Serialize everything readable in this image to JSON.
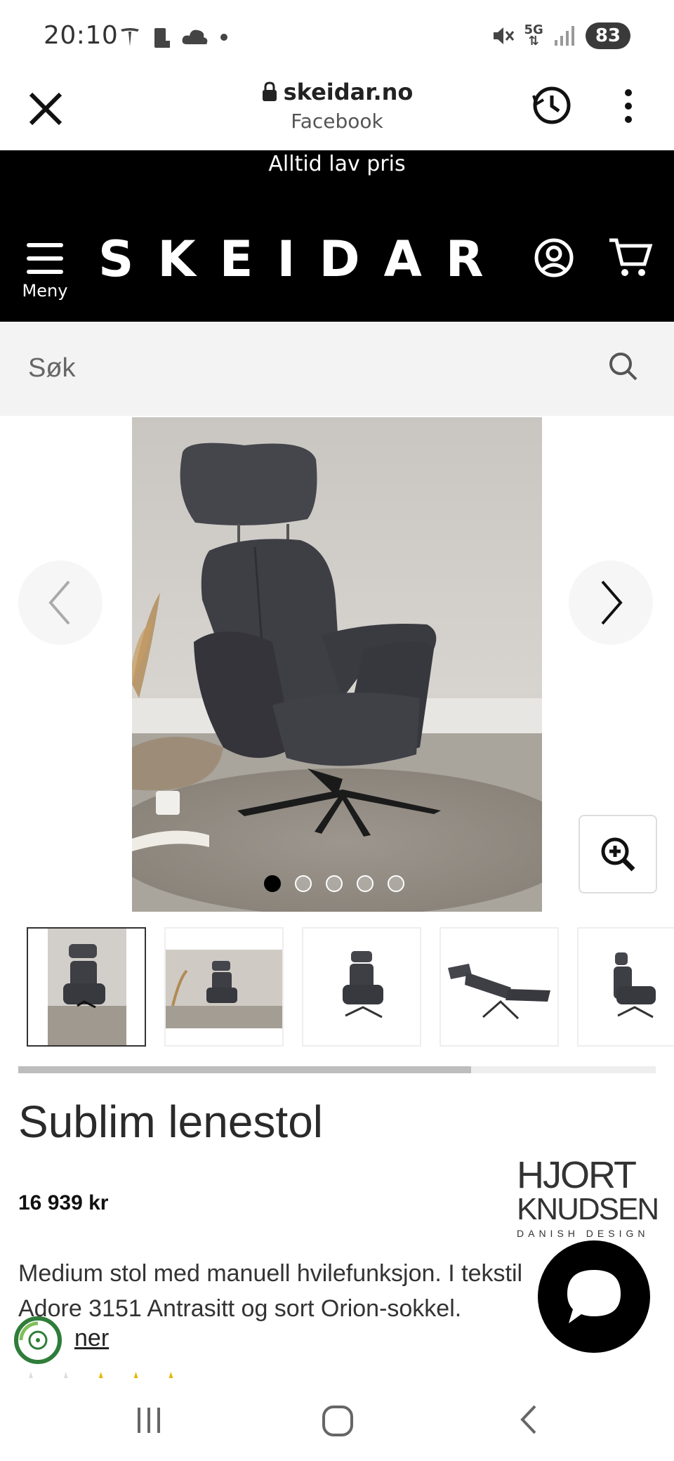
{
  "status_bar": {
    "time": "20:10",
    "network": "5G",
    "battery": "83",
    "left_icons": [
      "tesla-icon",
      "trash-icon",
      "cloud-icon",
      "dot-icon"
    ],
    "right_icons": [
      "mute-icon",
      "5g-icon",
      "signal-icon"
    ]
  },
  "browser": {
    "domain": "skeidar.no",
    "subtitle": "Facebook",
    "icons": [
      "close-icon",
      "lock-icon",
      "history-icon",
      "kebab-icon"
    ]
  },
  "promo": {
    "text": "Alltid lav pris"
  },
  "header": {
    "menu_label": "Meny",
    "logo_text": "SKEIDAR",
    "icons": [
      "menu-icon",
      "account-icon",
      "cart-icon"
    ]
  },
  "search": {
    "placeholder": "Søk",
    "icon": "search-icon"
  },
  "gallery": {
    "dot_count": 5,
    "active_dot": 1,
    "thumbnails": [
      "Thumbnail 1",
      "Thumbnail 2",
      "Thumbnail 3",
      "Thumbnail 4",
      "Thumbnail 5"
    ],
    "active_thumbnail": 1,
    "scroll_progress": 0.71,
    "icons": [
      "chevron-left-icon",
      "chevron-right-icon",
      "zoom-in-icon"
    ]
  },
  "product": {
    "title": "Sublim lenestol",
    "price": "16 939 kr",
    "description": "Medium stol med manuell hvilefunksjon. I tekstil Adore 3151 Antrasitt og sort Orion-sokkel.",
    "more_link": "ner",
    "brand_line1": "HJORT",
    "brand_line2": "KNUDSEN",
    "brand_line3": "DANISH DESIGN",
    "rating_stars": 3
  },
  "chat": {
    "icon": "chat-bubble-icon"
  },
  "eco": {
    "icon": "eco-badge-icon"
  },
  "nav": {
    "icons": [
      "recent-apps-icon",
      "home-icon",
      "back-icon"
    ]
  },
  "colors": {
    "header_bg": "#000000",
    "search_bg": "#f3f3f3",
    "text": "#2a2a2a",
    "star": "#e6b800"
  }
}
